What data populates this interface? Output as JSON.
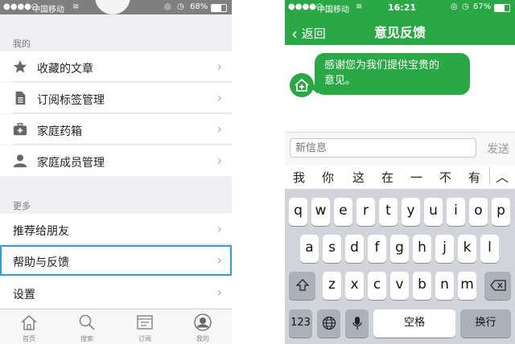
{
  "left_panel": {
    "status": {
      "carrier": "中国移动",
      "battery": "68%"
    },
    "section_mine": "我的",
    "mine_items": [
      {
        "label": "收藏的文章",
        "icon": "star-icon"
      },
      {
        "label": "订阅标签管理",
        "icon": "document-icon"
      },
      {
        "label": "家庭药箱",
        "icon": "medicine-box-icon"
      },
      {
        "label": "家庭成员管理",
        "icon": "person-icon"
      }
    ],
    "section_more": "更多",
    "more_items": [
      {
        "label": "推荐给朋友"
      },
      {
        "label": "帮助与反馈",
        "highlighted": true
      },
      {
        "label": "设置"
      }
    ],
    "tabs": [
      {
        "label": "首页",
        "icon": "home-icon"
      },
      {
        "label": "搜索",
        "icon": "search-icon"
      },
      {
        "label": "订阅",
        "icon": "subscribe-icon"
      },
      {
        "label": "我的",
        "icon": "profile-icon"
      }
    ]
  },
  "right_panel": {
    "status": {
      "carrier": "中国移动",
      "time": "16:21",
      "battery": "67%"
    },
    "back_label": "返回",
    "title": "意见反馈",
    "bot_message_line1": "感谢您为我们提供宝贵的",
    "bot_message_line2": "意见。",
    "input_placeholder": "新信息",
    "send_label": "发送",
    "candidates": [
      "我",
      "你",
      "这",
      "在",
      "一",
      "不",
      "有"
    ],
    "keyboard": {
      "row1": [
        "q",
        "w",
        "e",
        "r",
        "t",
        "y",
        "u",
        "i",
        "o",
        "p"
      ],
      "row2": [
        "a",
        "s",
        "d",
        "f",
        "g",
        "h",
        "j",
        "k",
        "l"
      ],
      "row3": [
        "z",
        "x",
        "c",
        "v",
        "b",
        "n",
        "m"
      ],
      "num_key": "123",
      "space_key": "空格",
      "return_key": "换行"
    }
  },
  "colors": {
    "accent_green": "#2aa846",
    "highlight_blue": "#2e9fd8"
  }
}
